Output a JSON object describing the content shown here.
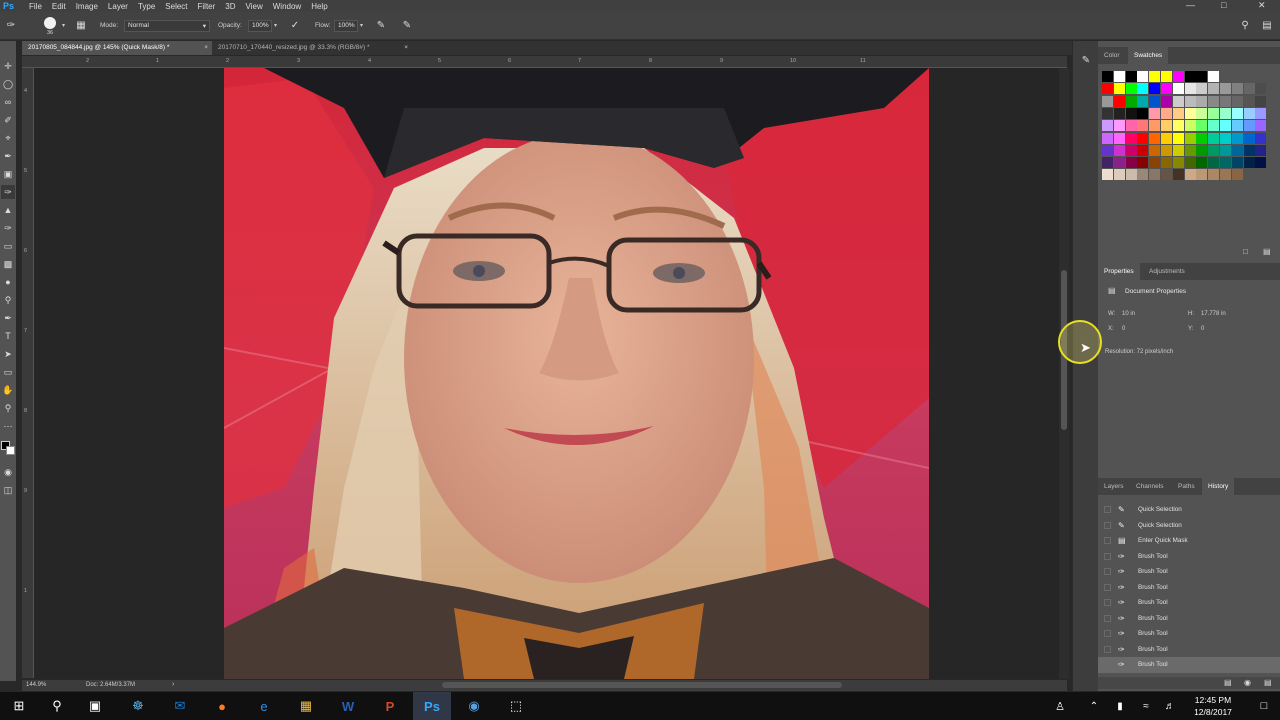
{
  "menubar": {
    "logo": "Ps",
    "items": [
      "File",
      "Edit",
      "Image",
      "Layer",
      "Type",
      "Select",
      "Filter",
      "3D",
      "View",
      "Window",
      "Help"
    ]
  },
  "options": {
    "brush_size": "36",
    "mode_label": "Mode:",
    "mode_value": "Normal",
    "opacity_label": "Opacity:",
    "opacity_value": "100%",
    "flow_label": "Flow:",
    "flow_value": "100%"
  },
  "tabs": [
    {
      "label": "20170805_084844.jpg @ 145% (Quick Mask/8) *",
      "active": true
    },
    {
      "label": "20170710_170440_resized.jpg @ 33.3% (RGB/8#) *",
      "active": false
    }
  ],
  "rulers": {
    "top": [
      "2",
      "1",
      "2",
      "3",
      "4",
      "5",
      "6",
      "7",
      "8",
      "9",
      "10",
      "11"
    ],
    "left": [
      "4",
      "5",
      "6",
      "7",
      "8",
      "9",
      "1"
    ]
  },
  "status": {
    "zoom": "144.9%",
    "doc": "Doc: 2.64M/3.37M"
  },
  "swatches_panel": {
    "tabs": [
      "Color",
      "Swatches"
    ],
    "active_tab": "Swatches"
  },
  "properties_panel": {
    "tabs": [
      "Properties",
      "Adjustments"
    ],
    "title": "Document Properties",
    "w_label": "W:",
    "w_value": "10 in",
    "h_label": "H:",
    "h_value": "17.778 in",
    "x_label": "X:",
    "x_value": "0",
    "y_label": "Y:",
    "y_value": "0",
    "resolution": "Resolution: 72 pixels/inch"
  },
  "history_panel": {
    "tabs": [
      "Layers",
      "Channels",
      "Paths",
      "History"
    ],
    "active_tab": "History",
    "items": [
      {
        "label": "Quick Selection",
        "icon": "quick-selection-icon"
      },
      {
        "label": "Quick Selection",
        "icon": "quick-selection-icon"
      },
      {
        "label": "Enter Quick Mask",
        "icon": "quick-mask-icon"
      },
      {
        "label": "Brush Tool",
        "icon": "brush-icon"
      },
      {
        "label": "Brush Tool",
        "icon": "brush-icon"
      },
      {
        "label": "Brush Tool",
        "icon": "brush-icon"
      },
      {
        "label": "Brush Tool",
        "icon": "brush-icon"
      },
      {
        "label": "Brush Tool",
        "icon": "brush-icon"
      },
      {
        "label": "Brush Tool",
        "icon": "brush-icon"
      },
      {
        "label": "Brush Tool",
        "icon": "brush-icon"
      },
      {
        "label": "Brush Tool",
        "icon": "brush-icon"
      }
    ]
  },
  "taskbar": {
    "time": "12:45 PM",
    "date": "12/8/2017"
  },
  "colors": {
    "quick_mask_red": "#c8283a",
    "ps_blue": "#31a8ff",
    "panel_bg": "#535353"
  }
}
